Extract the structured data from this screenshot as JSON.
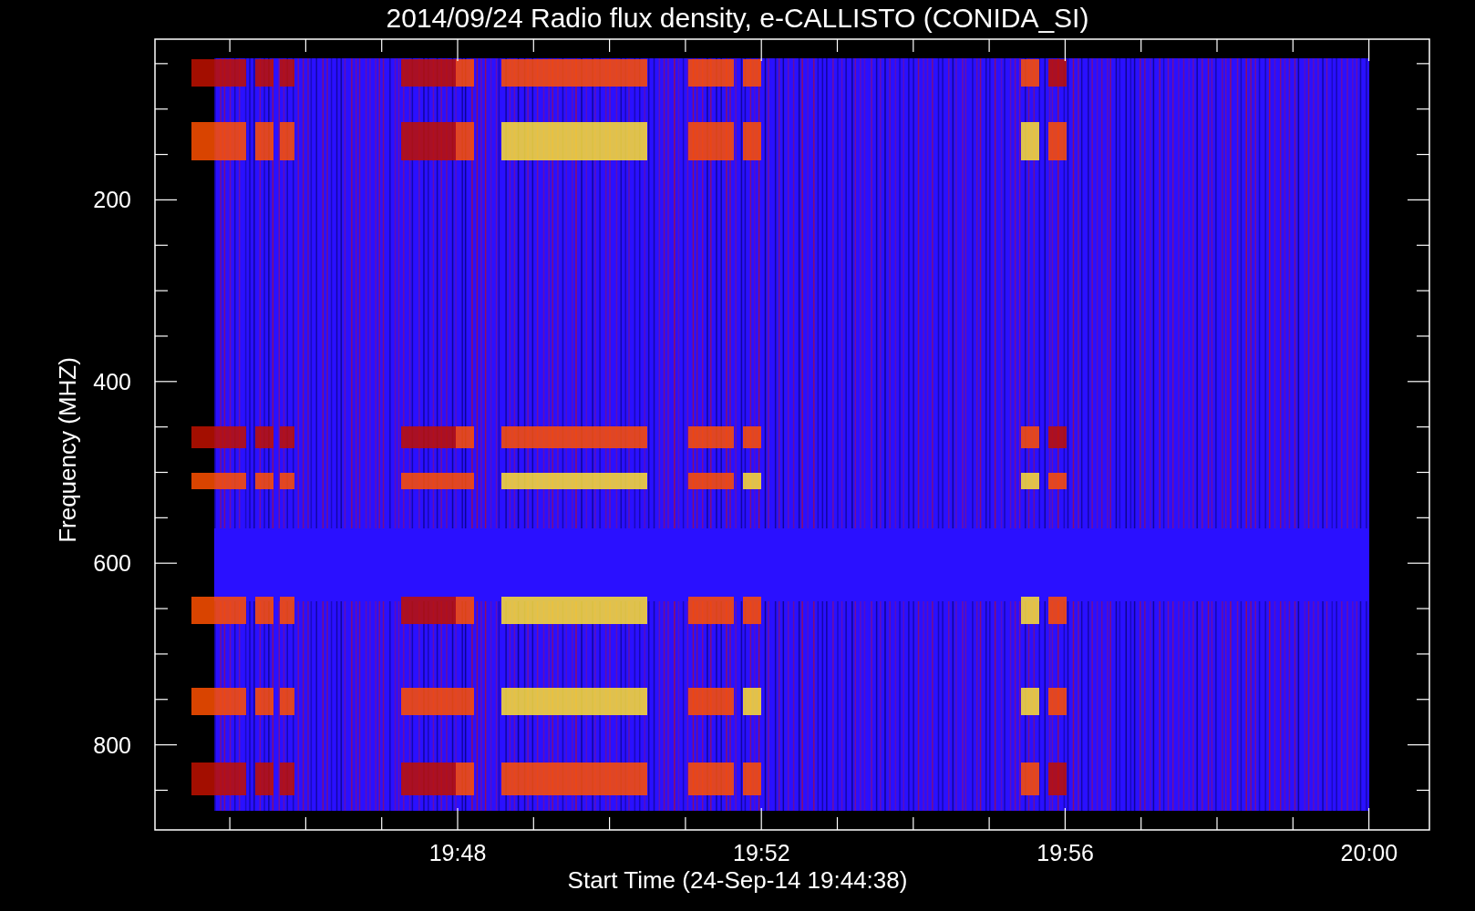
{
  "title": "2014/09/24  Radio flux density, e-CALLISTO (CONIDA_SI)",
  "y_axis": {
    "label": "Frequency (MHZ)",
    "tick_labels": [
      "200",
      "400",
      "600",
      "800"
    ]
  },
  "x_axis": {
    "label": "Start Time (24-Sep-14 19:44:38)",
    "tick_labels": [
      "19:48",
      "19:52",
      "19:56",
      "20:00"
    ]
  }
}
